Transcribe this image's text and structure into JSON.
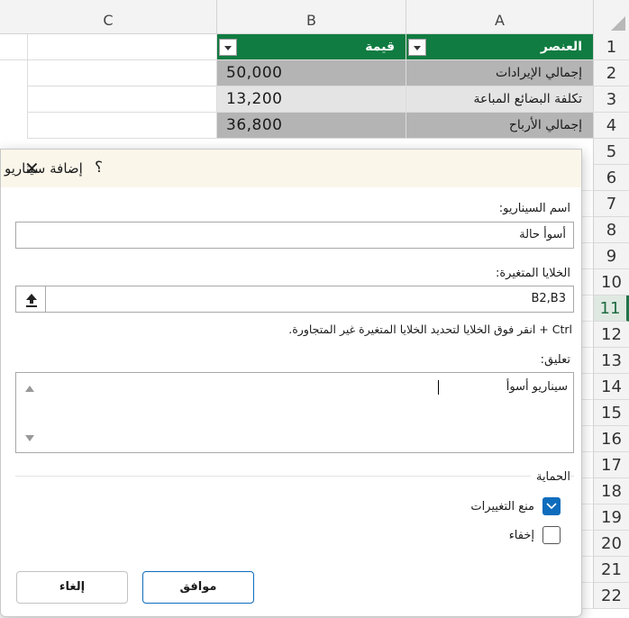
{
  "sheet": {
    "columns": [
      "C",
      "B",
      "A"
    ],
    "rows": [
      "1",
      "2",
      "3",
      "4",
      "5",
      "6",
      "7",
      "8",
      "9",
      "10",
      "11",
      "12",
      "13",
      "14",
      "15",
      "16",
      "17",
      "18",
      "19",
      "20",
      "21",
      "22"
    ],
    "active_row": "11",
    "header": {
      "item": "العنصر",
      "value": "قيمة"
    },
    "data": [
      {
        "item": "إجمالي الإيرادات",
        "value": "50,000"
      },
      {
        "item": "تكلفة البضائع المباعة",
        "value": "13,200"
      },
      {
        "item": "إجمالي الأرباح",
        "value": "36,800"
      }
    ]
  },
  "dialog": {
    "title": "إضافة سيناريو",
    "help": "؟",
    "close": "✕",
    "scenario_name_label": "اسم السيناريو:",
    "scenario_name_value": "أسوأ حالة",
    "changing_cells_label": "الخلايا المتغيرة:",
    "changing_cells_value": "B2,B3",
    "hint": "Ctrl + انقر فوق الخلايا لتحديد الخلايا المتغيرة غير المتجاورة.",
    "comment_label": "تعليق:",
    "comment_value": "سيناريو أسوأ",
    "protection_label": "الحماية",
    "prevent_changes_label": "منع التغييرات",
    "prevent_changes_checked": true,
    "hide_label": "إخفاء",
    "hide_checked": false,
    "ok_label": "موافق",
    "cancel_label": "إلغاء"
  }
}
